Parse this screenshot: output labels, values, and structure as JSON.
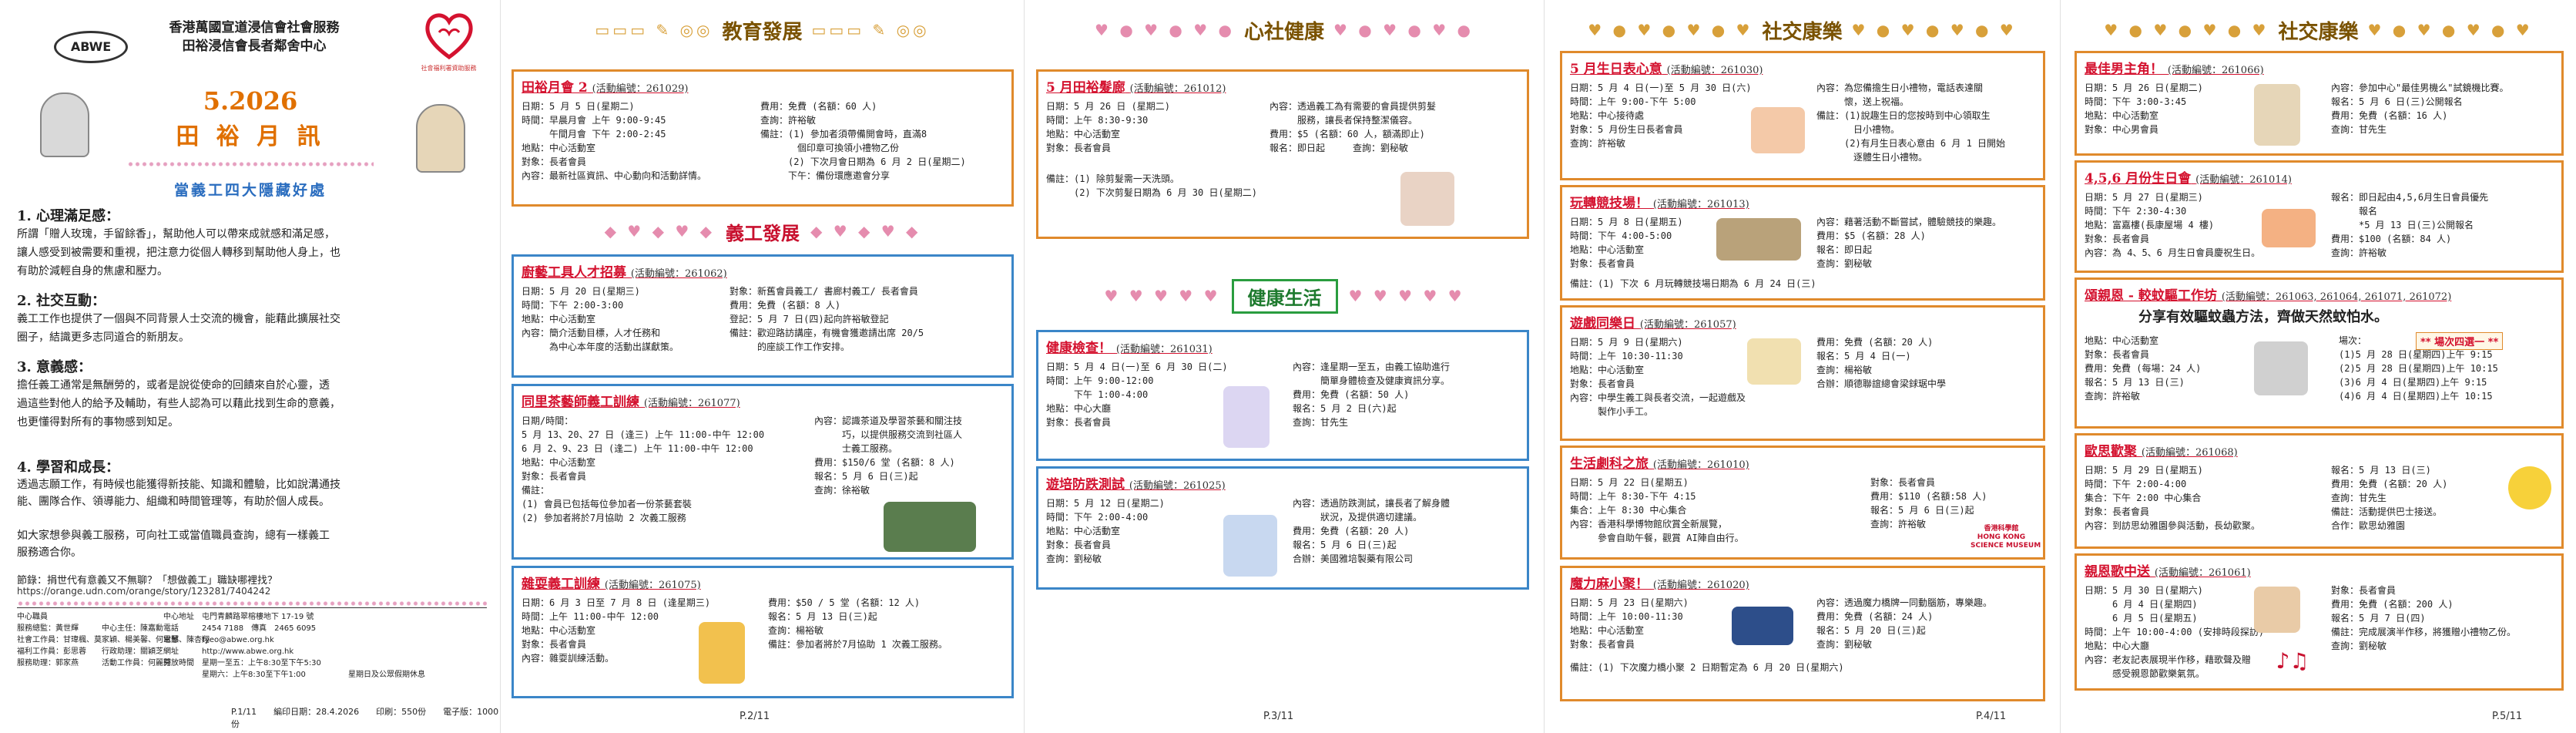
{
  "page1": {
    "org_name": "香港萬國宣道浸信會社會服務",
    "center_name": "田裕浸信會長者鄰舍中心",
    "logo_text": "ABWE",
    "heart_logo_caption": "社會福利署資助服務",
    "issue_date": "5.2026",
    "issue_title": "田 裕 月 訊",
    "theme": "當義工四大隱藏好處",
    "sections": [
      {
        "heading": "1. 心理滿足感：",
        "text": "所謂「贈人玫瑰，手留餘香」，幫助他人可以帶來成就感和滿足感，\n讓人感受到被需要和重視，把注意力從個人轉移到幫助他人身上，也\n有助於減輕自身的焦慮和壓力。"
      },
      {
        "heading": "2. 社交互動：",
        "text": "義工工作也提供了一個與不同背景人士交流的機會，能藉此擴展社交\n圈子，結識更多志同道合的新朋友。"
      },
      {
        "heading": "3. 意義感：",
        "text": "擔任義工通常是無酬勞的，或者是說從使命的回饋來自於心靈，透\n過這些對他人的給予及輔助，有些人認為可以藉此找到生命的意義，\n也更懂得對所有的事物感到知足。"
      },
      {
        "heading": "4. 學習和成長：",
        "text": "透過志願工作，有時候也能獲得新技能、知識和體驗，比如說溝通技\n能、團隊合作、領導能力、組織和時間管理等，有助於個人成長。\n\n如大家想參與義工服務，可向社工或當值職員查詢，總有一樣義工\n服務適合你。"
      }
    ],
    "source": "節錄：捐世代有意義又不無聊？「想做義工」職缺哪裡找？",
    "source_url": "https://orange.udn.com/orange/story/123281/7404242",
    "contact_col1": "中心職員\n服務總監：黃世輝　　　中心主任：陳嘉勳\n社會工作員：甘瑋楓、莫家穎、楊美馨、何思慧、陳杏翔\n福利工作員：彭思蓉　　行政助理：關穎芝\n服務助理：郭家燕　　　活動工作員：何麗芬",
    "contact_col2": "中心地址　屯門青麟路翠榕樓地下 17-19 號\n電話　　　2454 7188　傳真　2465 6095\n電郵　　　tyeo@abwe.org.hk\n網址　　　http://www.abwe.org.hk\n開放時間　星期一至五：上午8:30至下午5:30\n　　　　　星期六：上午8:30至下午1:00",
    "contact_col3": "\n\n\n\n\n星期日及公眾假期休息",
    "footer": "P.1/11　　編印日期：28.4.2026　　印刷：550份　　電子版：1000份"
  },
  "page2": {
    "banner_title": "教育發展",
    "volunteer_title": "義工發展",
    "activities": [
      {
        "title": "田裕月會 2",
        "code": "(活動編號：261029)",
        "left": "日期：5 月 5 日(星期二)\n時間：早晨月會 上午 9:00-9:45\n　　　午間月會 下午 2:00-2:45\n地點：中心活動室\n對象：長者會員\n內容：最新社區資訊、中心動向和活動詳情。",
        "right": "費用：免費 (名額：60 人)\n查詢：許裕敏\n備註：(1) 參加者須帶備開會時，直滿8\n　　　　個印章可換領小禮物乙份\n　　　(2) 下次月會日期為 6 月 2 日(星期二)\n　　　下午：備份環應邀會分享"
      },
      {
        "title": "廚藝工具人才招募",
        "code": "(活動編號：261062)",
        "left": "日期：5 月 20 日(星期三)\n時間：下午 2:00-3:00\n地點：中心活動室\n內容：簡介活動目標，人才任務和\n　　　為中心本年度的活動出謀獻策。",
        "right": "對象：新舊會員義工/ 書廊村義工/ 長者會員\n費用：免費 (名額：8 人)\n登記：5 月 7 日(四)起向許裕敏登記\n備註：歡迎路訪講座，有機會獲邀請出席 20/5\n　　　的座談工作工作安排。"
      },
      {
        "title": "同里茶藝師義工訓練",
        "code": "(活動編號：261077)",
        "left": "日期/時間：\n5 月 13、20、27 日 (逢三) 上午 11:00-中午 12:00\n6 月 2、9、23 日 (逢二) 上午 11:00-中午 12:00\n地點：中心活動室\n對象：長者會員\n備註：\n(1) 會員已包括每位參加者一份茶藝套裝\n(2) 參加者將於7月協助 2 次義工服務",
        "right": "內容：認識茶道及學習茶藝和關注技\n　　　巧，以提供服務交流到社區人\n　　　士義工服務。\n費用：$150/6 堂 (名額：8 人)\n報名：5 月 6 日(三)起\n查詢：徐裕敏"
      },
      {
        "title": "雜耍義工訓練",
        "code": "(活動編號：261075)",
        "left": "日期：6 月 3 日至 7 月 8 日 (逢星期三)\n時間：上午 11:00-中午 12:00\n地點：中心活動室\n對象：長者會員\n內容：雜耍訓練活動。",
        "right": "費用：$50 / 5 堂 (名額：12 人)\n報名：5 月 13 日(三)起\n查詢：楊裕敏\n備註：參加者將於7月協助 1 次義工服務。"
      }
    ],
    "page_number": "P.2/11"
  },
  "page3": {
    "banner_title": "心社健康",
    "health_title": "健康生活",
    "activities": [
      {
        "title": "5 月田裕髮廊",
        "code": "(活動編號：261012)",
        "left": "日期：5 月 26 日 (星期二)\n時間：上午 8:30-9:30\n地點：中心活動室\n對象：長者會員",
        "right": "內容：透過義工為有需要的會員提供剪髮\n　　　服務，讓長者保持整潔儀容。\n費用：$5 (名額：60 人，額滿即止)\n報名：即日起　　　查詢：劉秘敏",
        "note": "備註：(1) 除剪髮需一天洗頭。\n　　　(2) 下次剪髮日期為 6 月 30 日(星期二)"
      },
      {
        "title": "健康檢查！",
        "code": "(活動編號：261031)",
        "left": "日期：5 月 4 日(一)至 6 月 30 日(二)\n時間：上午 9:00-12:00\n　　　下午 1:00-4:00\n地點：中心大廳\n對象：長者會員",
        "right": "內容：逢星期一至五，由義工協助進行\n　　　簡單身體檢查及健康資訊分享。\n費用：免費 (名額：50 人)\n報名：5 月 2 日(六)起\n查詢：甘先生"
      },
      {
        "title": "遊培防跌測試",
        "code": "(活動編號：261025)",
        "left": "日期：5 月 12 日(星期二)\n時間：下午 2:00-4:00\n地點：中心活動室\n對象：長者會員\n查詢：劉秘敏",
        "right": "內容：透過防跌測試，讓長者了解身體\n　　　狀況，及提供適切建議。\n費用：免費 (名額：20 人)\n報名：5 月 6 日(三)起\n合辦：美國雅培製藥有限公司"
      }
    ],
    "page_number": "P.3/11"
  },
  "page4": {
    "banner_title": "社交康樂",
    "activities": [
      {
        "title": "5 月生日表心意",
        "code": "(活動編號：261030)",
        "left": "日期：5 月 4 日(一)至 5 月 30 日(六)\n時間：上午 9:00-下午 5:00\n地點：中心接待處\n對象：5 月份生日長者會員\n查詢：許裕敏",
        "right": "內容：為您備擔生日小禮物，電話表達關\n　　　懷，送上祝福。\n備註：(1)說趣生日的您按時到中心領取生\n　　　　日小禮物。\n　　　(2)有月生日表心意由 6 月 1 日開始\n　　　　逐體生日小禮物。"
      },
      {
        "title": "玩轉競技場！",
        "code": "(活動編號：261013)",
        "left": "日期：5 月 8 日(星期五)\n時間：下午 4:00-5:00\n地點：中心活動室\n對象：長者會員",
        "right": "內容：藉著活動不斷嘗試，體驗競技的樂趣。\n費用：$5 (名額：28 人)\n報名：即日起\n查詢：劉秘敏",
        "note": "備註：(1) 下次 6 月玩轉競技場日期為 6 月 24 日(三)"
      },
      {
        "title": "遊戲同樂日",
        "code": "(活動編號：261057)",
        "left": "日期：5 月 9 日(星期六)\n時間：上午 10:30-11:30\n地點：中心活動室\n對象：長者會員\n內容：中學生義工與長者交流，一起遊戲及\n　　　製作小手工。",
        "right": "費用：免費 (名額：20 人)\n報名：5 月 4 日(一)\n查詢：楊裕敏\n合辦：順德聯誼總會梁銶琚中學"
      },
      {
        "title": "生活劇科之旅",
        "code": "(活動編號：261010)",
        "left": "日期：5 月 22 日(星期五)\n時間：上午 8:30-下午 4:15\n集合：上午 8:30 中心集合\n內容：香港科學博物館欣賞全新展覽，\n　　　參會自助午餐，觀賞 AI陣自由行。",
        "right": "對象：長者會員\n費用：$110 (名額:58 人)\n報名：5 月 6 日(三)起\n查詢：許裕敏"
      },
      {
        "title": "魔力麻小聚！",
        "code": "(活動編號：261020)",
        "left": "日期：5 月 23 日(星期六)\n時間：上午 10:00-11:30\n地點：中心活動室\n對象：長者會員",
        "right": "內容：透過魔力橋牌一同動腦筋，專樂趣。\n費用：免費 (名額：24 人)\n報名：5 月 20 日(三)起\n查詢：劉秘敏",
        "note": "備註：(1) 下次魔力橋小聚 2 日期暫定為 6 月 20 日(星期六)"
      }
    ],
    "museum_label": "香港科學館\nHONG KONG\nSCIENCE MUSEUM",
    "page_number": "P.4/11"
  },
  "page5": {
    "banner_title": "社交康樂",
    "activities": [
      {
        "title": "最佳男主角！",
        "code": "(活動編號：261066)",
        "left": "日期：5 月 26 日(星期二)\n時間：下午 3:00-3:45\n地點：中心活動室\n對象：中心男會員",
        "right": "內容：參加中心\"最佳男機么\"試鏡機比賽。\n報名：5 月 6 日(三)公開報名\n費用：免費 (名額：16 人)\n查詢：甘先生"
      },
      {
        "title": "4,5,6 月份生日會",
        "code": "(活動編號：261014)",
        "left": "日期：5 月 27 日(星期三)\n時間：下午 2:30-4:30\n地點：富嘉樓(長康屋場 4 樓)\n對象：長者會員\n內容：為 4、5、6 月生日會員慶祝生日。",
        "right": "報名：即日起由4,5,6月生日會員優先\n　　　報名\n　　　*5 月 13 日(三)公開報名\n費用：$100 (名額：84 人)\n查詢：許裕敏"
      },
      {
        "title": "頌親恩 - 較蚊驅工作坊",
        "code": "(活動編號：261063, 261064, 261071, 261072)",
        "slogan": "分享有效驅蚊蟲方法，齊做天然蚊怕水。",
        "tag": "** 場次四選一 **",
        "left": "地點：中心活動室\n對象：長者會員\n費用：免費 (每場：24 人)\n報名：5 月 13 日(三)\n查詢：許裕敏",
        "right": "場次：\n(1)5 月 28 日(星期四)上午 9:15\n(2)5 月 28 日(星期四)上午 10:15\n(3)6 月 4 日(星期四)上午 9:15\n(4)6 月 4 日(星期四)上午 10:15"
      },
      {
        "title": "歐思歡聚",
        "code": "(活動編號：261068)",
        "left": "日期：5 月 29 日(星期五)\n時間：下午 2:00-4:00\n集合：下午 2:00 中心集合\n對象：長者會員\n內容：到訪思幼雅園參與活動，長幼歡聚。",
        "right": "報名：5 月 13 日(三)\n費用：免費 (名額：20 人)\n查詢：甘先生\n備註：活動提供巴士接送。\n合作：歐思幼雅園"
      },
      {
        "title": "親恩歌中送",
        "code": "(活動編號：261061)",
        "left": "日期：5 月 30 日(星期六)\n　　　6 月 4 日(星期四)\n　　　6 月 5 日(星期五)\n時間：上午 10:00-4:00 (安排時段探訪)\n地點：中心大廳\n內容：老友記表展現半作移，藉歌聲及贈\n　　　感受親恩節歡樂氣氛。",
        "right": "對象：長者會員\n費用：免費 (名額：200 人)\n報名：5 月 7 日(四)\n備註：完成展演半作移，將獲贈小禮物乙份。\n查詢：劉秘敏"
      }
    ],
    "page_number": "P.5/11"
  }
}
